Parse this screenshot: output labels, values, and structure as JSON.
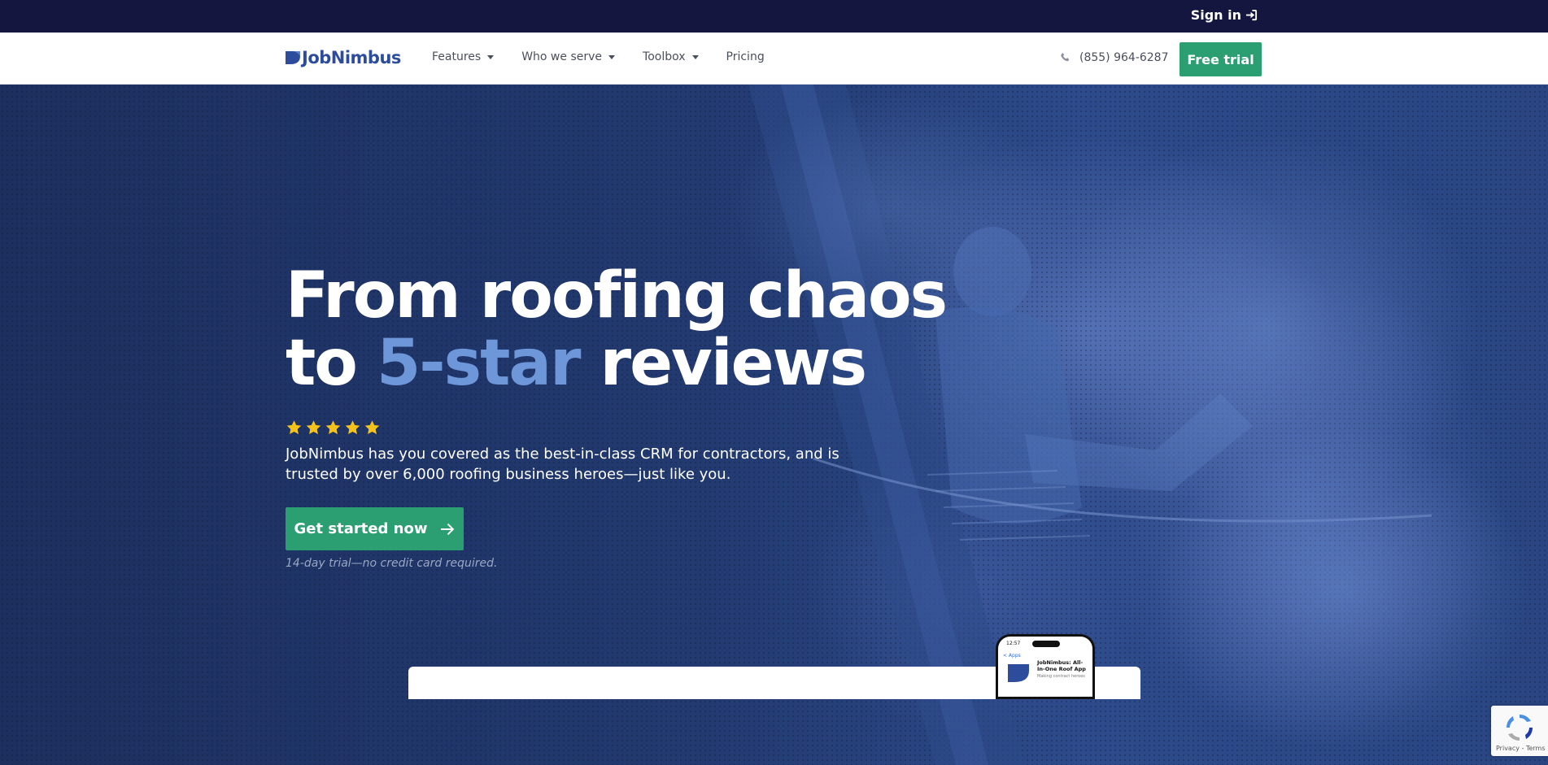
{
  "topbar": {
    "signin_label": "Sign in",
    "signin_icon": "sign-in-icon"
  },
  "nav": {
    "logo_text": "JobNimbus",
    "items": [
      {
        "label": "Features",
        "has_dropdown": true
      },
      {
        "label": "Who we serve",
        "has_dropdown": true
      },
      {
        "label": "Toolbox",
        "has_dropdown": true
      },
      {
        "label": "Pricing",
        "has_dropdown": false
      }
    ],
    "phone": "(855) 964-6287",
    "phone_icon": "phone-icon",
    "cta_label": "Free trial"
  },
  "hero": {
    "title_line1": "From roofing chaos",
    "title_line2_prefix": "to ",
    "title_line2_accent": "5-star",
    "title_line2_suffix": " reviews",
    "rating_stars": 5,
    "description": "JobNimbus has you covered as the best-in-class CRM for contractors, and is trusted by over 6,000 roofing business heroes—just like you.",
    "cta_label": "Get started now",
    "cta_icon": "arrow-right-icon",
    "note": "14-day trial—no credit card required."
  },
  "phone_preview": {
    "time": "12:57",
    "back_label": "< Apps",
    "app_title": "JobNimbus: All-In-One Roof App",
    "app_subtitle": "Making contract heroes"
  },
  "recaptcha": {
    "links": "Privacy - Terms"
  },
  "colors": {
    "topbar_bg": "#15163f",
    "brand_blue": "#2d4d9c",
    "accent_green": "#2c9f72",
    "accent_light_blue": "#6d97d8",
    "star_yellow": "#f6c21a"
  }
}
